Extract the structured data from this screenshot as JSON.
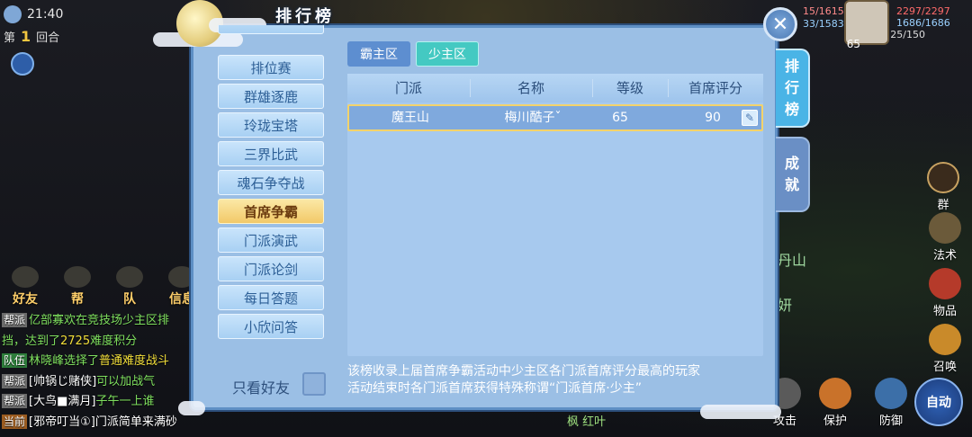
{
  "status": {
    "time": "21:40"
  },
  "round": {
    "prefix": "第",
    "number": "1",
    "suffix": "回合"
  },
  "dialog": {
    "title": "排行榜",
    "close_label": "✕",
    "categories": [
      {
        "label": "排位赛",
        "active": false
      },
      {
        "label": "群雄逐鹿",
        "active": false
      },
      {
        "label": "玲珑宝塔",
        "active": false
      },
      {
        "label": "三界比武",
        "active": false
      },
      {
        "label": "魂石争夺战",
        "active": false
      },
      {
        "label": "首席争霸",
        "active": true
      },
      {
        "label": "门派演武",
        "active": false
      },
      {
        "label": "门派论剑",
        "active": false
      },
      {
        "label": "每日答题",
        "active": false
      },
      {
        "label": "小欣问答",
        "active": false
      }
    ],
    "friends_only_label": "只看好友",
    "tabs": {
      "overlord": "霸主区",
      "young": "少主区"
    },
    "table": {
      "headers": [
        "门派",
        "名称",
        "等级",
        "首席评分"
      ],
      "rows": [
        {
          "school": "魔王山",
          "name": "梅川酷子ˇ",
          "level": "65",
          "score": "90"
        }
      ]
    },
    "notice": [
      "该榜收录上届首席争霸活动中少主区各门派首席评分最高的玩家",
      "活动结束时各门派首席获得特殊称谓“门派首席·少主”"
    ],
    "side_tabs": {
      "ranking": [
        "排",
        "行",
        "榜"
      ],
      "achievement": [
        "成",
        "就"
      ]
    }
  },
  "side_buttons": [
    "好友",
    "帮",
    "队",
    "信息"
  ],
  "chat": [
    {
      "tag": "帮派",
      "text_a": "亿部寡欢在竞技场少主区排",
      "text_b": ""
    },
    {
      "tag": "",
      "text_a": "挡，达到了",
      "number": "2725",
      "text_b": "难度积分"
    },
    {
      "tag": "队伍",
      "text_a": "林晓峰选择了",
      "highlight": "普通难度战斗"
    },
    {
      "tag": "帮派",
      "text_a": "[帅锅じ赌侠]",
      "text_b": "可以加战气"
    },
    {
      "tag": "帮派",
      "text_a": "[大鸟■满月]",
      "text_b": "子午一上谁"
    },
    {
      "tag": "当前",
      "text_a": "[邪帝叮当①]",
      "text_b": "门派简单来满砂"
    }
  ],
  "hud": {
    "hp": "2297/2297",
    "mp": "1686/1686",
    "energy": "25/150",
    "level": "65",
    "other_hp": "15/1615",
    "other_mp": "33/1583",
    "icons": {
      "skill": "法术",
      "item": "物品",
      "summon": "召唤",
      "protect": "保护",
      "defend": "防御",
      "attack": "攻击",
      "auto": "自动"
    },
    "map_label": "丹山",
    "map_label2": "妍",
    "group_label": "群"
  },
  "bottom": {
    "text": "枫 红叶"
  }
}
